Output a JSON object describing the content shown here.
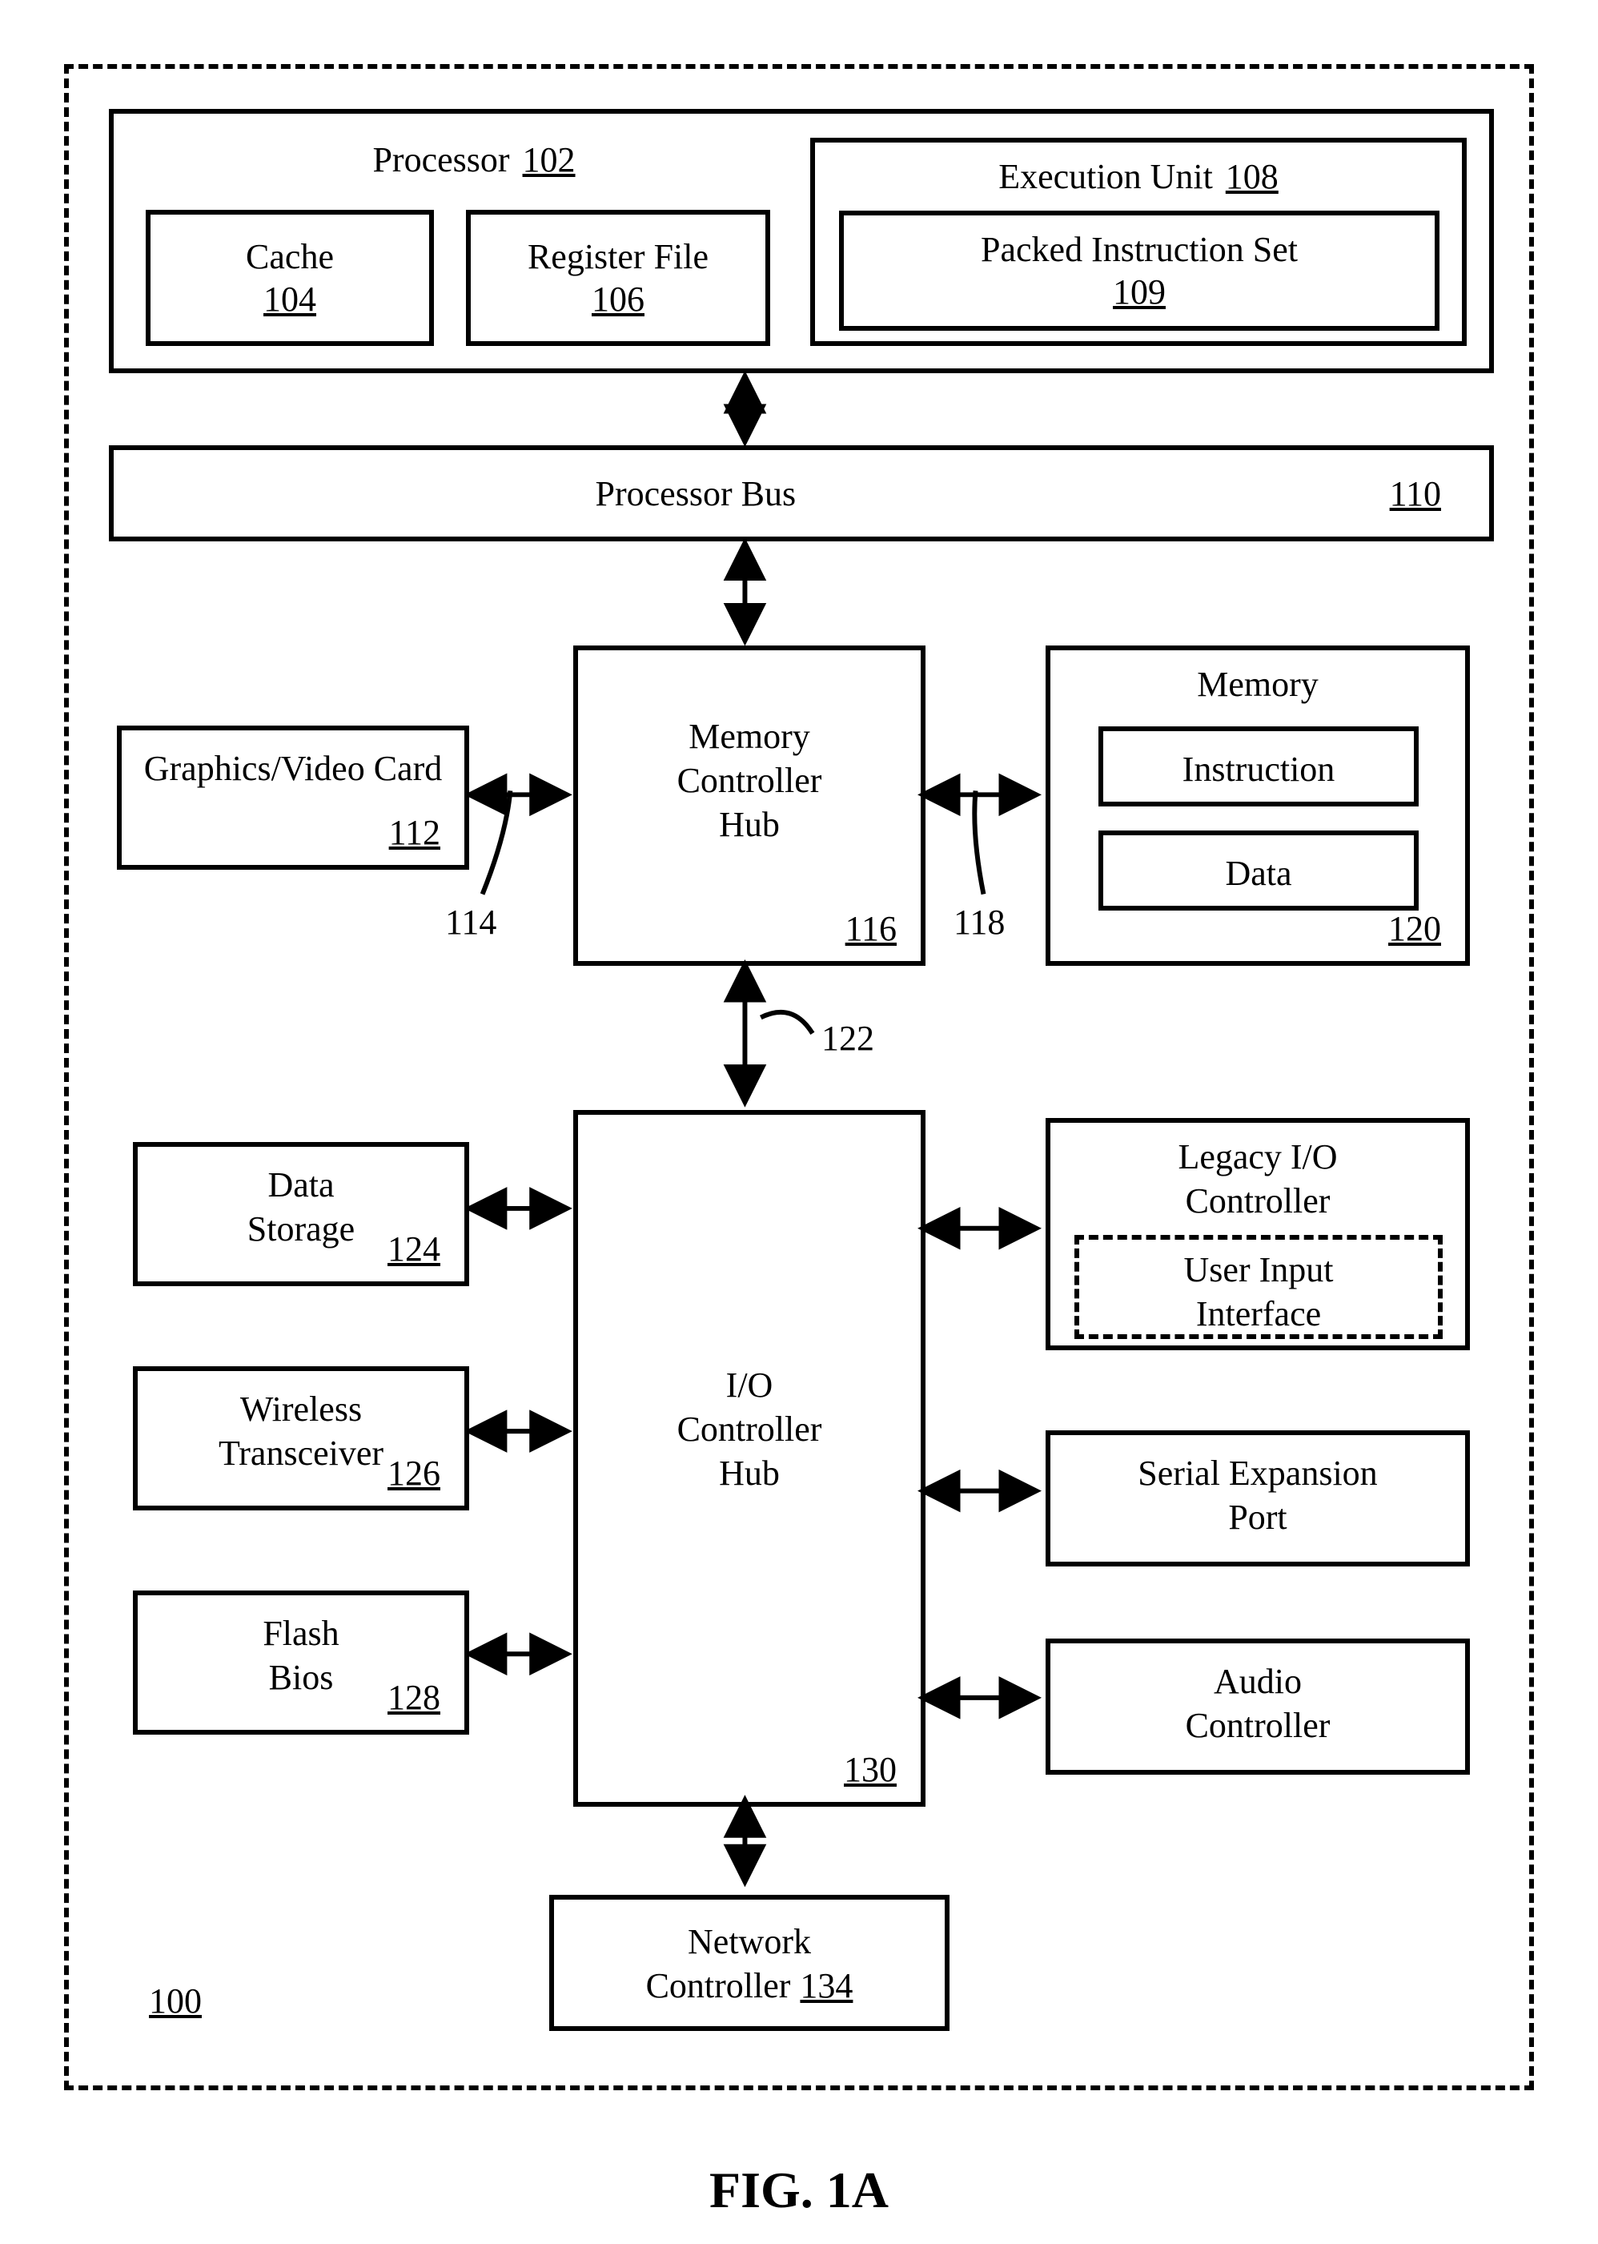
{
  "figure": "FIG. 1A",
  "system_ref": "100",
  "processor": {
    "label": "Processor",
    "ref": "102"
  },
  "cache": {
    "label": "Cache",
    "ref": "104"
  },
  "register_file": {
    "label": "Register File",
    "ref": "106"
  },
  "execution_unit": {
    "label": "Execution Unit",
    "ref": "108"
  },
  "packed_instruction_set": {
    "label": "Packed Instruction Set",
    "ref": "109"
  },
  "processor_bus": {
    "label": "Processor Bus",
    "ref": "110"
  },
  "graphics_card": {
    "label": "Graphics/Video Card",
    "ref": "112"
  },
  "bus_114": "114",
  "mch": {
    "label": "Memory Controller Hub",
    "ref": "116"
  },
  "bus_118": "118",
  "memory": {
    "label": "Memory",
    "ref": "120"
  },
  "instruction": {
    "label": "Instruction"
  },
  "data": {
    "label": "Data"
  },
  "bus_122": "122",
  "data_storage": {
    "label": "Data Storage",
    "ref": "124"
  },
  "wireless": {
    "label": "Wireless Transceiver",
    "ref": "126"
  },
  "flash_bios": {
    "label": "Flash Bios",
    "ref": "128"
  },
  "ich": {
    "label": "I/O Controller Hub",
    "ref": "130"
  },
  "legacy": {
    "label": "Legacy I/O Controller"
  },
  "user_input": {
    "label": "User Input Interface"
  },
  "serial_port": {
    "label": "Serial Expansion Port"
  },
  "audio": {
    "label": "Audio Controller"
  },
  "network": {
    "label": "Network Controller",
    "ref": "134"
  }
}
